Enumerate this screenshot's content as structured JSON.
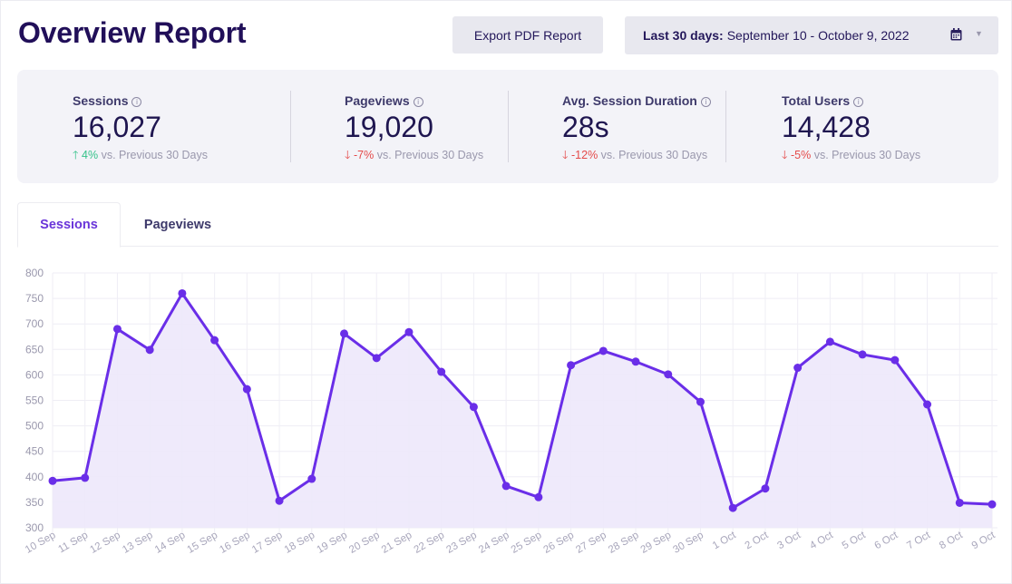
{
  "header": {
    "title": "Overview Report",
    "export_label": "Export PDF Report",
    "date_range_prefix": "Last 30 days:",
    "date_range_value": "September 10 - October 9, 2022",
    "calendar_icon": "calendar-icon",
    "caret_icon": "caret-down-icon"
  },
  "stats": [
    {
      "label": "Sessions",
      "value": "16,027",
      "delta": "4%",
      "direction": "up",
      "compare": "vs. Previous 30 Days"
    },
    {
      "label": "Pageviews",
      "value": "19,020",
      "delta": "-7%",
      "direction": "down",
      "compare": "vs. Previous 30 Days"
    },
    {
      "label": "Avg. Session Duration",
      "value": "28s",
      "delta": "-12%",
      "direction": "down",
      "compare": "vs. Previous 30 Days"
    },
    {
      "label": "Total Users",
      "value": "14,428",
      "delta": "-5%",
      "direction": "down",
      "compare": "vs. Previous 30 Days"
    }
  ],
  "tabs": [
    {
      "label": "Sessions",
      "active": true
    },
    {
      "label": "Pageviews",
      "active": false
    }
  ],
  "colors": {
    "accent": "#6a35d9",
    "line": "#6a2ee8",
    "fill": "#ede8fb",
    "up": "#35c28a",
    "down": "#e44a4a"
  },
  "chart_data": {
    "type": "area",
    "title": "",
    "xlabel": "",
    "ylabel": "",
    "series": [
      {
        "name": "Sessions",
        "values": [
          392,
          398,
          690,
          649,
          760,
          668,
          572,
          353,
          396,
          681,
          633,
          684,
          606,
          537,
          382,
          360,
          619,
          647,
          626,
          601,
          547,
          339,
          377,
          614,
          665,
          640,
          629,
          542,
          349,
          346
        ]
      }
    ],
    "categories": [
      "10 Sep",
      "11 Sep",
      "12 Sep",
      "13 Sep",
      "14 Sep",
      "15 Sep",
      "16 Sep",
      "17 Sep",
      "18 Sep",
      "19 Sep",
      "20 Sep",
      "21 Sep",
      "22 Sep",
      "23 Sep",
      "24 Sep",
      "25 Sep",
      "26 Sep",
      "27 Sep",
      "28 Sep",
      "29 Sep",
      "30 Sep",
      "1 Oct",
      "2 Oct",
      "3 Oct",
      "4 Oct",
      "5 Oct",
      "6 Oct",
      "7 Oct",
      "8 Oct",
      "9 Oct"
    ],
    "ylim": [
      300,
      800
    ],
    "yticks": [
      300,
      350,
      400,
      450,
      500,
      550,
      600,
      650,
      700,
      750,
      800
    ],
    "grid": true,
    "legend": "none"
  }
}
